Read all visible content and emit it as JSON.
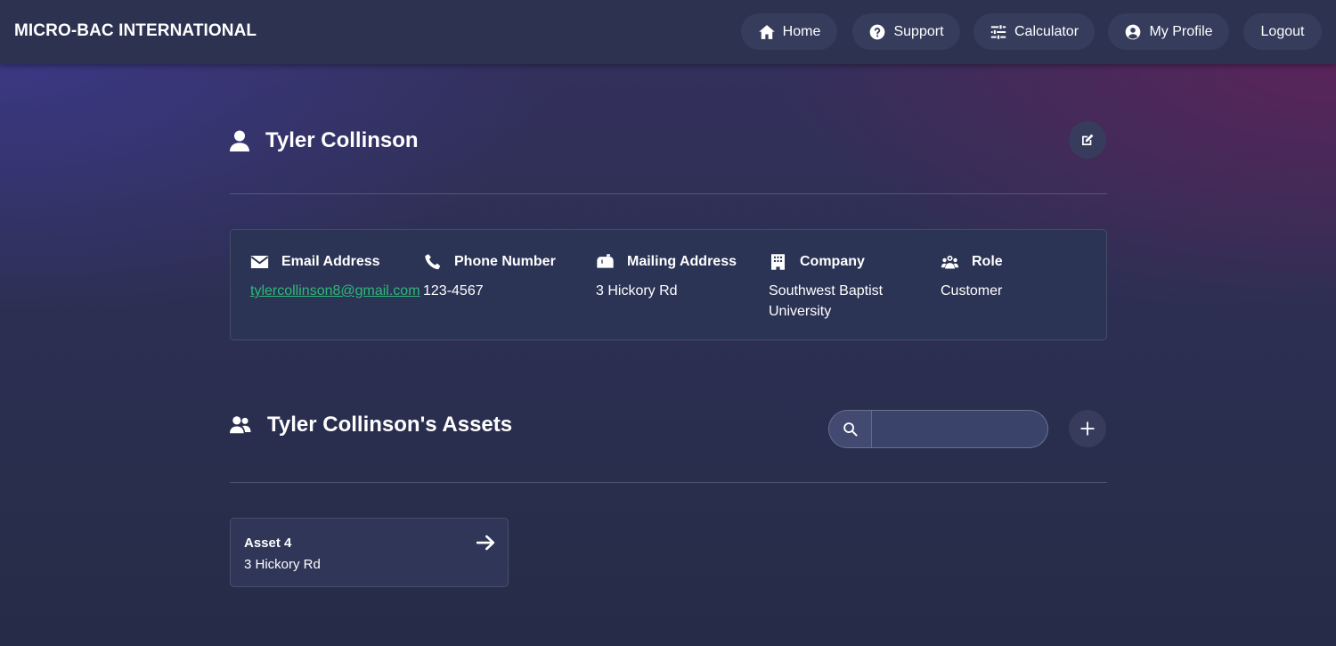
{
  "nav": {
    "brand": "MICRO-BAC INTERNATIONAL",
    "items": [
      {
        "label": "Home",
        "icon": "home-icon"
      },
      {
        "label": "Support",
        "icon": "question-circle-icon"
      },
      {
        "label": "Calculator",
        "icon": "sliders-icon"
      },
      {
        "label": "My Profile",
        "icon": "user-circle-icon"
      },
      {
        "label": "Logout",
        "icon": ""
      }
    ]
  },
  "profile": {
    "name": "Tyler Collinson",
    "edit_icon": "edit-icon",
    "fields": {
      "email": {
        "label": "Email Address",
        "value": "tylercollinson8@gmail.com"
      },
      "phone": {
        "label": "Phone Number",
        "value": "123-4567"
      },
      "mailing": {
        "label": "Mailing Address",
        "value": "3 Hickory Rd"
      },
      "company": {
        "label": "Company",
        "value": "Southwest Baptist University"
      },
      "role": {
        "label": "Role",
        "value": "Customer"
      }
    }
  },
  "assets": {
    "title": "Tyler Collinson's Assets",
    "search": {
      "value": "",
      "placeholder": ""
    },
    "items": [
      {
        "name": "Asset 4",
        "address": "3 Hickory Rd"
      }
    ]
  },
  "colors": {
    "accent_link": "#2eb879",
    "navbar": "#2c3250",
    "card": "#2c3455"
  }
}
